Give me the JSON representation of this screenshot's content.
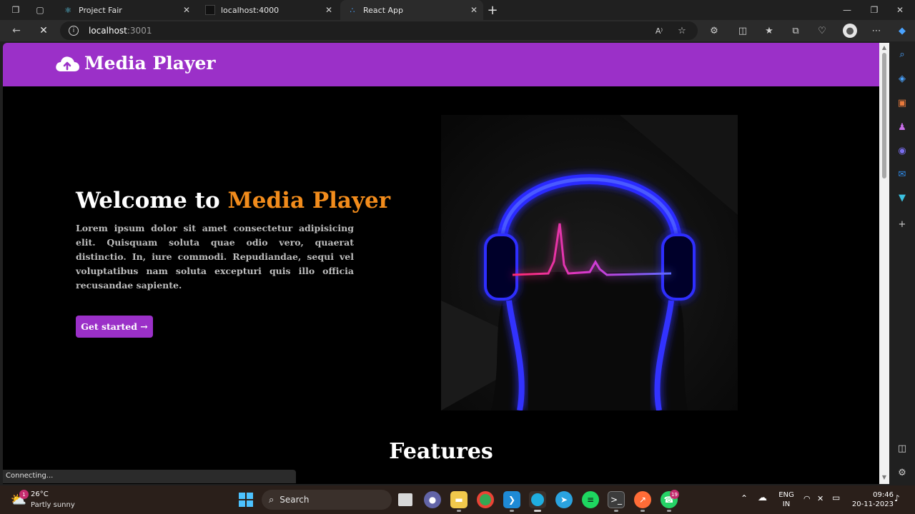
{
  "browser": {
    "tabs": [
      {
        "title": "Project Fair",
        "icon": "react-icon"
      },
      {
        "title": "localhost:4000",
        "icon": "dark-page-icon"
      },
      {
        "title": "React App",
        "icon": "loading-icon",
        "active": true
      }
    ],
    "url_host": "localhost",
    "url_port": ":3001",
    "status_text": "Connecting..."
  },
  "app": {
    "brand": "Media Player",
    "hero": {
      "title_prefix": "Welcome to ",
      "title_accent": "Media Player",
      "text": "Lorem ipsum dolor sit amet consectetur adipisicing elit. Quisquam soluta quae odio vero, quaerat distinctio. In, iure commodi. Repudiandae, sequi vel voluptatibus nam soluta excepturi quis illo officia recusandae sapiente.",
      "cta": "Get started →"
    },
    "features_heading": "Features"
  },
  "taskbar": {
    "weather_temp": "26°C",
    "weather_desc": "Partly sunny",
    "weather_badge": "1",
    "search_label": "Search",
    "lang_top": "ENG",
    "lang_bottom": "IN",
    "time": "09:46",
    "date": "20-11-2023",
    "whatsapp_badge": "19"
  },
  "colors": {
    "brand_purple": "#9b30c8",
    "accent_orange": "#f28c1c"
  }
}
